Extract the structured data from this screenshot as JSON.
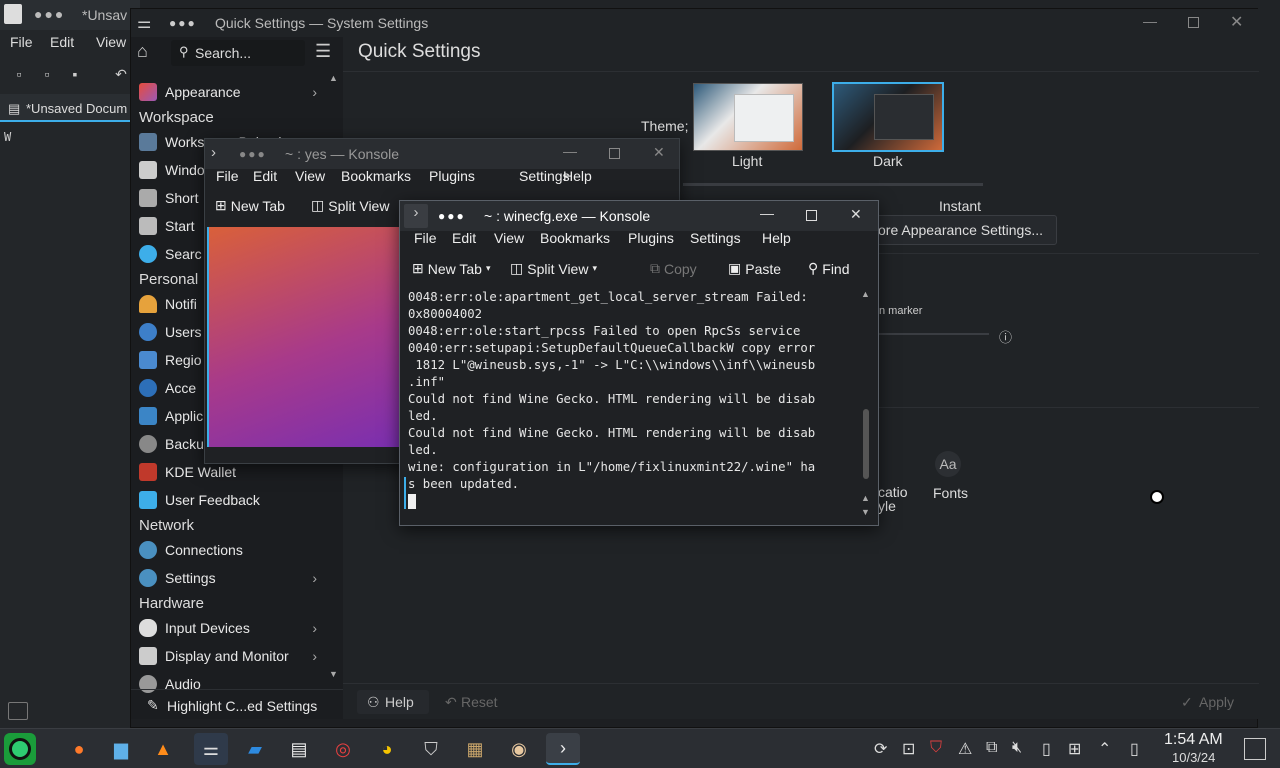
{
  "kate": {
    "title": "*Unsav",
    "menu": [
      "File",
      "Edit",
      "View"
    ],
    "tab_label": "*Unsaved Docum",
    "editor_text": "W"
  },
  "settings": {
    "window_title": "Quick Settings — System Settings",
    "search_placeholder": "Search...",
    "page_title": "Quick Settings",
    "sidebar": {
      "top_item": "Appearance",
      "groups": [
        {
          "heading": "Workspace",
          "items": [
            "Workspace Behavi...",
            "Windo",
            "Short",
            "Start",
            "Searc"
          ]
        },
        {
          "heading": "Personal",
          "items": [
            "Notifi",
            "Users",
            "Regio",
            "Acce",
            "Applic",
            "Backu",
            "KDE Wallet",
            "User Feedback"
          ]
        },
        {
          "heading": "Network",
          "items": [
            "Connections",
            "Settings"
          ]
        },
        {
          "heading": "Hardware",
          "items": [
            "Input Devices",
            "Display and Monitor",
            "Audio"
          ]
        }
      ],
      "highlight_button": "Highlight C...ed Settings"
    },
    "theme_label": "Theme;",
    "themes": [
      "Light",
      "Dark"
    ],
    "animation_right_label": "Instant",
    "more_appearance_button": "ore Appearance Settings...",
    "marker_label": "n marker",
    "shortcut_items": [
      "catio\nyle",
      "Fonts"
    ],
    "fonts_icon_text": "Aa",
    "help_button": "Help",
    "reset_button": "Reset",
    "apply_button": "Apply",
    "accent_color": "#3daee9"
  },
  "konsole_back": {
    "title": "~ : yes — Konsole",
    "menu": [
      "File",
      "Edit",
      "View",
      "Bookmarks",
      "Plugins",
      "Settings",
      "Help"
    ],
    "toolbar": [
      "New Tab",
      "Split View"
    ]
  },
  "konsole_front": {
    "title": "~ : winecfg.exe — Konsole",
    "menu": [
      "File",
      "Edit",
      "View",
      "Bookmarks",
      "Plugins",
      "Settings",
      "Help"
    ],
    "toolbar": {
      "new_tab": "New Tab",
      "split_view": "Split View",
      "copy": "Copy",
      "paste": "Paste",
      "find": "Find"
    },
    "terminal_lines": [
      "0048:err:ole:apartment_get_local_server_stream Failed:",
      "0x80004002",
      "0048:err:ole:start_rpcss Failed to open RpcSs service",
      "0040:err:setupapi:SetupDefaultQueueCallbackW copy error",
      " 1812 L\"@wineusb.sys,-1\" -> L\"C:\\\\windows\\\\inf\\\\wineusb",
      ".inf\"",
      "Could not find Wine Gecko. HTML rendering will be disab",
      "led.",
      "Could not find Wine Gecko. HTML rendering will be disab",
      "led.",
      "wine: configuration in L\"/home/fixlinuxmint22/.wine\" ha",
      "s been updated."
    ]
  },
  "taskbar": {
    "clock_time": "1:54 AM",
    "clock_date": "10/3/24",
    "apps": [
      "firefox-icon",
      "files-icon",
      "vlc-icon",
      "settings-icon",
      "discover-icon",
      "document-icon",
      "lifebuoy-icon",
      "pacman-icon",
      "shield-icon",
      "archive-icon",
      "eye-icon",
      "konsole-icon"
    ]
  }
}
